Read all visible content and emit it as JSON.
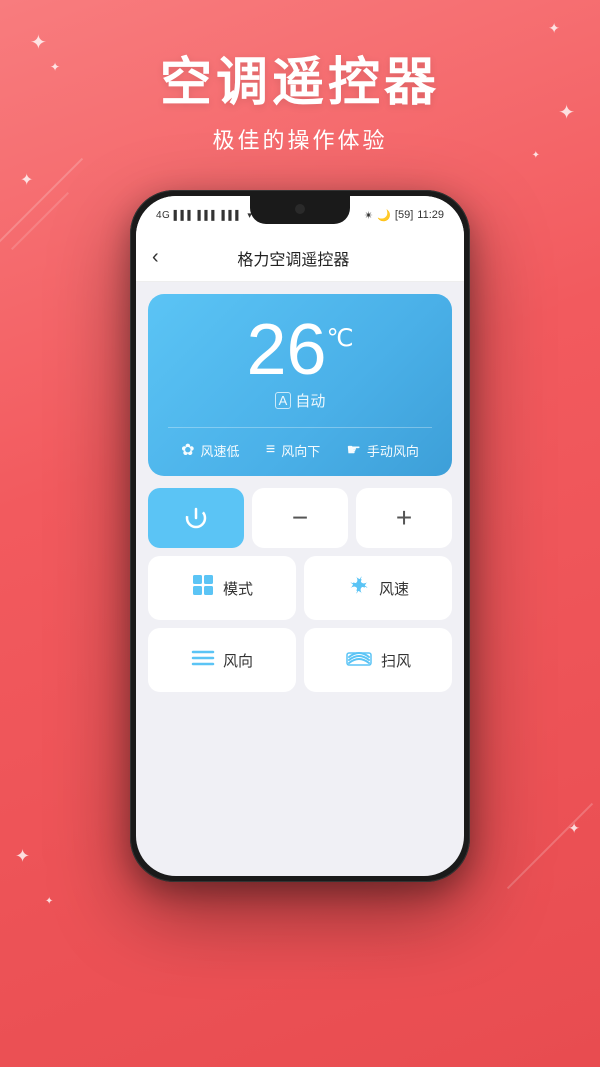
{
  "background": {
    "color_top": "#f87c7e",
    "color_bottom": "#e84c50"
  },
  "header": {
    "main_title": "空调遥控器",
    "sub_title": "极佳的操作体验"
  },
  "status_bar": {
    "signal": "4G",
    "signal_bars": "|||",
    "wifi": "WiFi",
    "bluetooth": "BT",
    "battery": "59",
    "time": "11:29"
  },
  "app_bar": {
    "back_label": "‹",
    "title": "格力空调遥控器"
  },
  "ac_display": {
    "temperature": "26",
    "unit": "℃",
    "mode_label": "A 自动",
    "info_items": [
      {
        "icon": "fan",
        "label": "风速低"
      },
      {
        "icon": "wind-dir",
        "label": "风向下"
      },
      {
        "icon": "manual",
        "label": "手动风向"
      }
    ]
  },
  "controls": {
    "power_button": "⏻",
    "minus_button": "−",
    "plus_button": "+",
    "function_buttons": [
      {
        "icon": "⊞",
        "label": "模式"
      },
      {
        "icon": "✿",
        "label": "风速"
      },
      {
        "icon": "≡",
        "label": "风向"
      },
      {
        "icon": "⊟",
        "label": "扫风"
      }
    ]
  }
}
